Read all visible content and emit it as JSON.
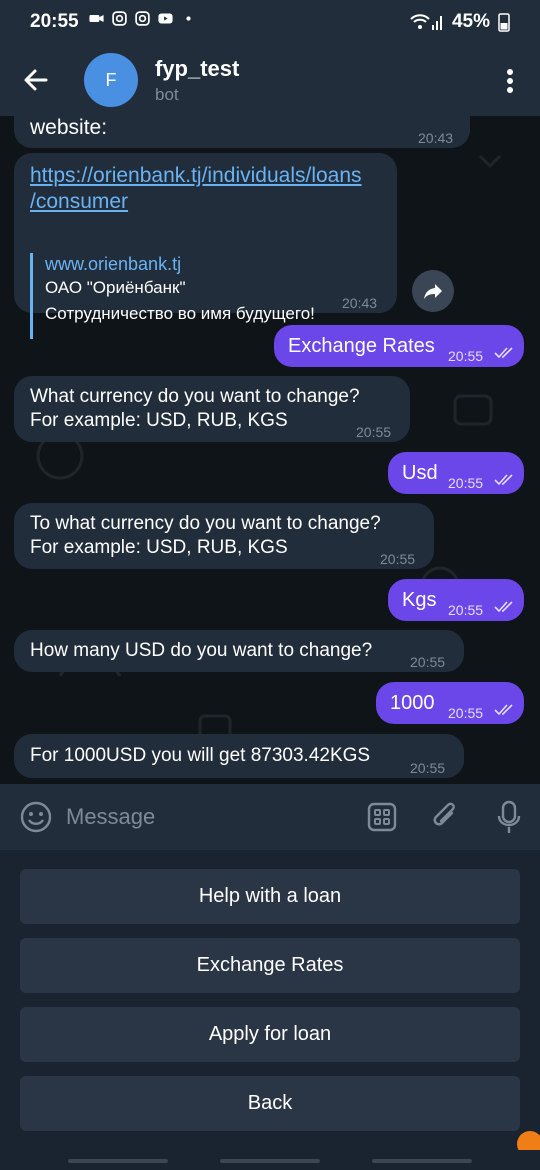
{
  "status_bar": {
    "time": "20:55",
    "battery": "45%"
  },
  "header": {
    "avatar_letter": "F",
    "title": "fyp_test",
    "subtitle": "bot"
  },
  "messages": [
    {
      "text": "website:",
      "time": "20:43"
    },
    {
      "link": "https://orienbank.tj/individuals/loans/consumer",
      "preview_site": "www.orienbank.tj",
      "preview_title": "ОАО \"Ориёнбанк\"",
      "preview_desc": "Сотрудничество во имя будущего!",
      "time": "20:43"
    },
    {
      "text": "Exchange Rates",
      "time": "20:55"
    },
    {
      "line1": "What currency do you want to change?",
      "line2": "For example: USD, RUB, KGS",
      "time": "20:55"
    },
    {
      "text": "Usd",
      "time": "20:55"
    },
    {
      "line1": "To what currency do you want to change?",
      "line2": "For example: USD, RUB, KGS",
      "time": "20:55"
    },
    {
      "text": "Kgs",
      "time": "20:55"
    },
    {
      "text": "How many USD do you want to change?",
      "time": "20:55"
    },
    {
      "text": "1000",
      "time": "20:55"
    },
    {
      "text": "For 1000USD you will get 87303.42KGS",
      "time": "20:55"
    }
  ],
  "composer": {
    "placeholder": "Message"
  },
  "keyboard": {
    "buttons": [
      "Help with a loan",
      "Exchange Rates",
      "Apply for loan",
      "Back"
    ]
  },
  "colors": {
    "accent": "#6b46e8",
    "link": "#6ab3f3",
    "bubble_in": "#212d3b"
  }
}
